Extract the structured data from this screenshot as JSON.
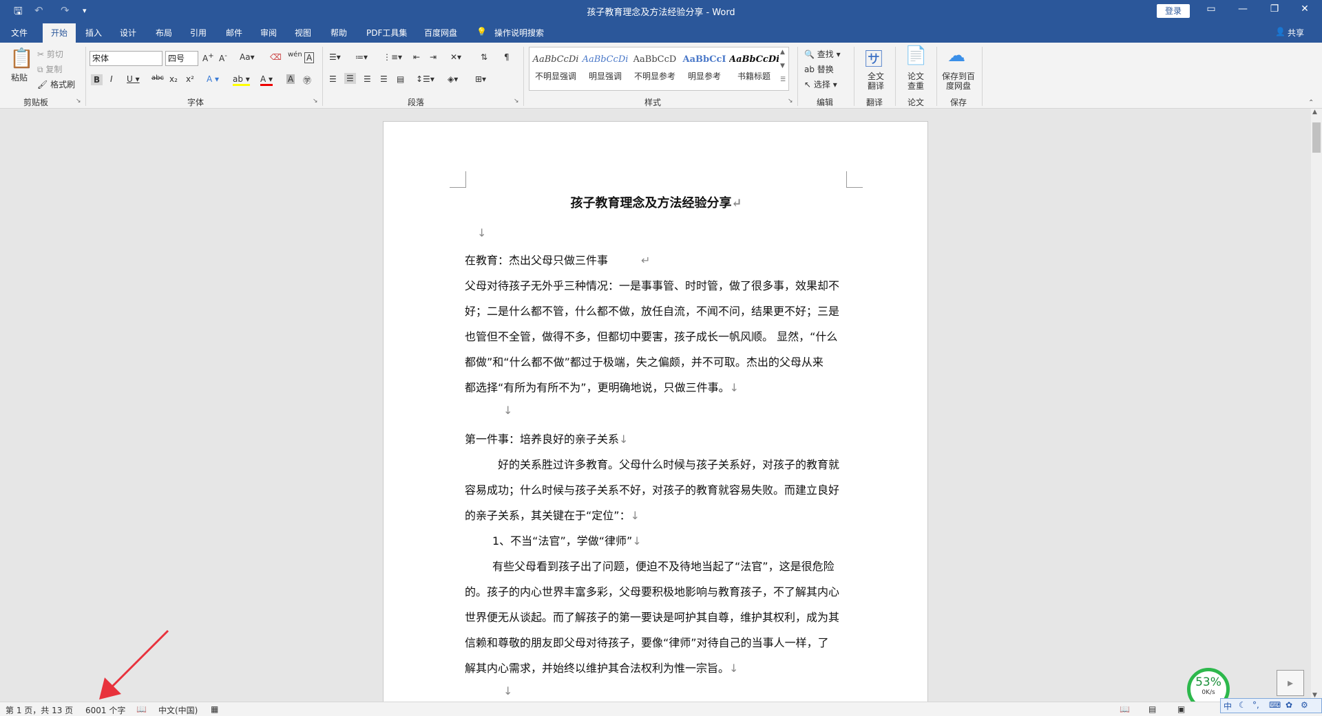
{
  "titlebar": {
    "title": "孩子教育理念及方法经验分享 - Word",
    "login_label": "登录"
  },
  "tabs": {
    "file": "文件",
    "home": "开始",
    "insert": "插入",
    "design": "设计",
    "layout": "布局",
    "references": "引用",
    "mailings": "邮件",
    "review": "审阅",
    "view": "视图",
    "help": "帮助",
    "pdf": "PDF工具集",
    "baidu": "百度网盘",
    "tellme": "操作说明搜索",
    "share": "共享"
  },
  "ribbon": {
    "clipboard": {
      "paste": "粘贴",
      "cut": "剪切",
      "copy": "复制",
      "format_painter": "格式刷",
      "label": "剪贴板"
    },
    "font": {
      "font_name": "宋体",
      "font_size": "四号",
      "label": "字体"
    },
    "paragraph": {
      "label": "段落"
    },
    "styles": {
      "label": "样式",
      "items": [
        {
          "preview": "AaBbCcDi",
          "name": "不明显强调"
        },
        {
          "preview": "AaBbCcDi",
          "name": "明显强调"
        },
        {
          "preview": "AaBbCcD",
          "name": "不明显参考"
        },
        {
          "preview": "AaBbCcI",
          "name": "明显参考"
        },
        {
          "preview": "AaBbCcDi",
          "name": "书籍标题"
        }
      ]
    },
    "editing": {
      "find": "查找",
      "replace": "替换",
      "select": "选择",
      "label": "编辑"
    },
    "translate": {
      "btn": "全文翻译",
      "label": "翻译"
    },
    "paper": {
      "btn": "论文查重",
      "label": "论文"
    },
    "save": {
      "btn": "保存到百度网盘",
      "label": "保存"
    }
  },
  "document": {
    "title": "孩子教育理念及方法经验分享",
    "lines": [
      "在教育：杰出父母只做三件事",
      "父母对待孩子无外乎三种情况：一是事事管、时时管，做了很多事，效果却不",
      "好；二是什么都不管，什么都不做，放任自流，不闻不问，结果更不好；三是",
      "也管但不全管，做得不多，但都切中要害，孩子成长一帆风顺。 显然，“什么",
      "都做”和“什么都不做”都过于极端，失之偏颇，并不可取。杰出的父母从来",
      "都选择“有所为有所不为”，更明确地说，只做三件事。",
      "第一件事：培养良好的亲子关系",
      "好的关系胜过许多教育。父母什么时候与孩子关系好，对孩子的教育就",
      "容易成功；什么时候与孩子关系不好，对孩子的教育就容易失败。而建立良好",
      "的亲子关系，其关键在于“定位”：",
      "1、不当“法官”，学做“律师”",
      "有些父母看到孩子出了问题，便迫不及待地当起了“法官”，这是很危险",
      "的。孩子的内心世界丰富多彩，父母要积极地影响与教育孩子，不了解其内心",
      "世界便无从谈起。而了解孩子的第一要诀是呵护其自尊，维护其权利，成为其",
      "信赖和尊敬的朋友即父母对待孩子，要像“律师”对待自己的当事人一样，了",
      "解其内心需求，并始终以维护其合法权利为惟一宗旨。"
    ]
  },
  "status": {
    "page": "第 1 页，共 13 页",
    "words": "6001 个字",
    "language": "中文(中国)"
  },
  "widget": {
    "percent": "53%",
    "speed": "0K/s"
  },
  "ime": {
    "mode": "中"
  },
  "colors": {
    "accent": "#2b579a",
    "widget_ring": "#2db84c",
    "arrow": "#e8323c"
  }
}
